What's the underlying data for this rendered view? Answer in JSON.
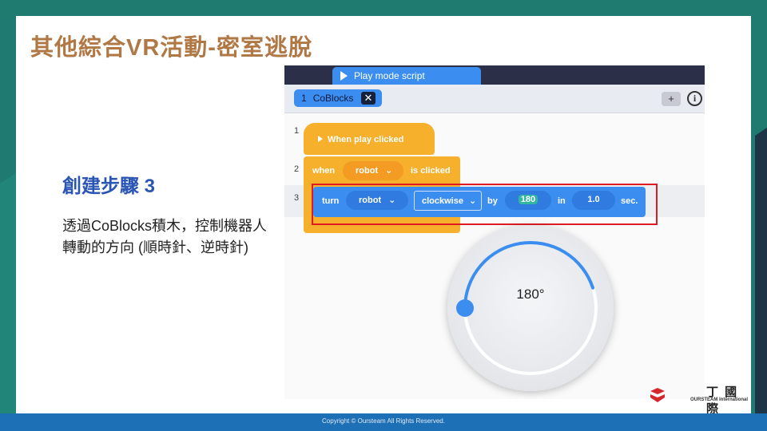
{
  "slide": {
    "title": "其他綜合VR活動-密室逃脫",
    "step_title": "創建步驟 3",
    "step_description": "透過CoBlocks積木，控制機器人轉動的方向 (順時針、逆時針)",
    "footer": "Copyright © Oursteam All Rights Reserved.",
    "logo_cn": "丁 國 際",
    "logo_en": "OURSTEAM International"
  },
  "editor": {
    "play_tab": "Play mode script",
    "script_tab_number": "1",
    "script_tab_label": "CoBlocks",
    "close_symbol": "✕",
    "add_symbol": "+",
    "info_symbol": "i",
    "line_numbers": [
      "1",
      "2",
      "3"
    ],
    "block_play": "When play clicked",
    "block_when": "when",
    "block_when_target": "robot",
    "block_is_clicked": "is clicked",
    "block_turn": "turn",
    "block_turn_target": "robot",
    "block_direction": "clockwise",
    "block_by": "by",
    "block_degrees": "180",
    "block_in": "in",
    "block_seconds": "1.0",
    "block_sec": "sec.",
    "dropdown_arrow": "⌄",
    "dial_value": "180°",
    "dial_fraction": 0.5
  },
  "colors": {
    "title": "#b07845",
    "step_title": "#2a55b5",
    "event_block": "#f7b02b",
    "motion_block": "#3b8ef0",
    "highlight": "#e11b22",
    "footer": "#1d6fb6"
  }
}
